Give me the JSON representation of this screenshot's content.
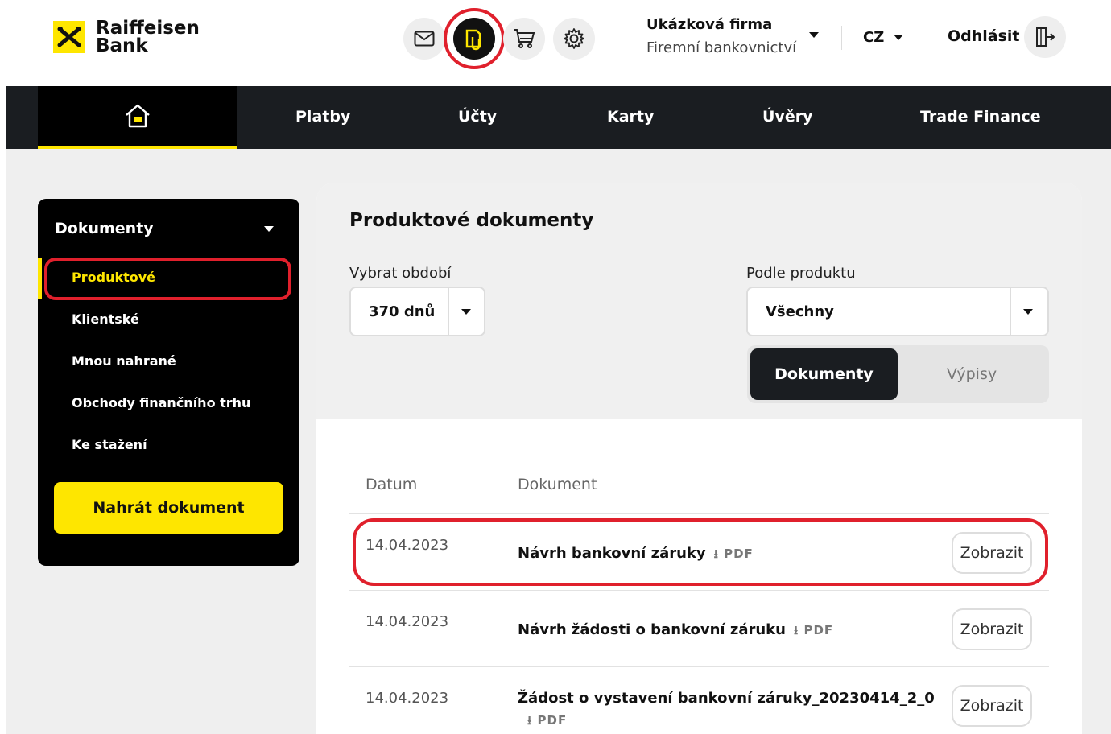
{
  "header": {
    "brand_line1": "Raiffeisen",
    "brand_line2": "Bank",
    "icons": [
      "mail-icon",
      "documents-icon",
      "cart-icon",
      "settings-icon"
    ],
    "company_name": "Ukázková firma",
    "company_sub": "Firemní bankovnictví",
    "language": "CZ",
    "logout_label": "Odhlásit"
  },
  "nav": {
    "items": [
      {
        "label": "Platby"
      },
      {
        "label": "Účty"
      },
      {
        "label": "Karty"
      },
      {
        "label": "Úvěry"
      },
      {
        "label": "Trade Finance"
      }
    ]
  },
  "sidebar": {
    "title": "Dokumenty",
    "items": [
      {
        "label": "Produktové",
        "active": true
      },
      {
        "label": "Klientské"
      },
      {
        "label": "Mnou nahrané"
      },
      {
        "label": "Obchody finančního trhu"
      },
      {
        "label": "Ke stažení"
      }
    ],
    "upload_button": "Nahrát dokument"
  },
  "main": {
    "title": "Produktové dokumenty",
    "period_label": "Vybrat období",
    "period_value": "370 dnů",
    "product_label": "Podle produktu",
    "product_value": "Všechny",
    "toggle_active": "Dokumenty",
    "toggle_inactive": "Výpisy",
    "table": {
      "col_date": "Datum",
      "col_document": "Dokument",
      "pdf_label": "PDF",
      "show_label": "Zobrazit",
      "rows": [
        {
          "date": "14.04.2023",
          "document": "Návrh bankovní záruky"
        },
        {
          "date": "14.04.2023",
          "document": "Návrh žádosti o bankovní záruku"
        },
        {
          "date": "14.04.2023",
          "document": "Žádost o vystavení bankovní záruky_20230414_2_0"
        }
      ]
    }
  },
  "colors": {
    "brand_yellow": "#fee600",
    "highlight_red": "#e0202c",
    "nav_dark": "#1a1d21"
  }
}
